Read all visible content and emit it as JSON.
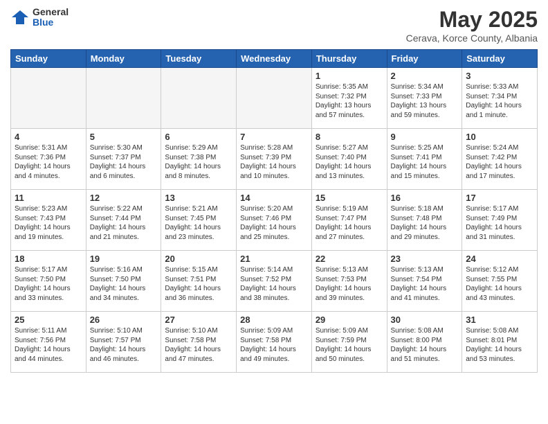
{
  "logo": {
    "general": "General",
    "blue": "Blue"
  },
  "title": "May 2025",
  "subtitle": "Cerava, Korce County, Albania",
  "headers": [
    "Sunday",
    "Monday",
    "Tuesday",
    "Wednesday",
    "Thursday",
    "Friday",
    "Saturday"
  ],
  "weeks": [
    [
      {
        "num": "",
        "info": ""
      },
      {
        "num": "",
        "info": ""
      },
      {
        "num": "",
        "info": ""
      },
      {
        "num": "",
        "info": ""
      },
      {
        "num": "1",
        "info": "Sunrise: 5:35 AM\nSunset: 7:32 PM\nDaylight: 13 hours\nand 57 minutes."
      },
      {
        "num": "2",
        "info": "Sunrise: 5:34 AM\nSunset: 7:33 PM\nDaylight: 13 hours\nand 59 minutes."
      },
      {
        "num": "3",
        "info": "Sunrise: 5:33 AM\nSunset: 7:34 PM\nDaylight: 14 hours\nand 1 minute."
      }
    ],
    [
      {
        "num": "4",
        "info": "Sunrise: 5:31 AM\nSunset: 7:36 PM\nDaylight: 14 hours\nand 4 minutes."
      },
      {
        "num": "5",
        "info": "Sunrise: 5:30 AM\nSunset: 7:37 PM\nDaylight: 14 hours\nand 6 minutes."
      },
      {
        "num": "6",
        "info": "Sunrise: 5:29 AM\nSunset: 7:38 PM\nDaylight: 14 hours\nand 8 minutes."
      },
      {
        "num": "7",
        "info": "Sunrise: 5:28 AM\nSunset: 7:39 PM\nDaylight: 14 hours\nand 10 minutes."
      },
      {
        "num": "8",
        "info": "Sunrise: 5:27 AM\nSunset: 7:40 PM\nDaylight: 14 hours\nand 13 minutes."
      },
      {
        "num": "9",
        "info": "Sunrise: 5:25 AM\nSunset: 7:41 PM\nDaylight: 14 hours\nand 15 minutes."
      },
      {
        "num": "10",
        "info": "Sunrise: 5:24 AM\nSunset: 7:42 PM\nDaylight: 14 hours\nand 17 minutes."
      }
    ],
    [
      {
        "num": "11",
        "info": "Sunrise: 5:23 AM\nSunset: 7:43 PM\nDaylight: 14 hours\nand 19 minutes."
      },
      {
        "num": "12",
        "info": "Sunrise: 5:22 AM\nSunset: 7:44 PM\nDaylight: 14 hours\nand 21 minutes."
      },
      {
        "num": "13",
        "info": "Sunrise: 5:21 AM\nSunset: 7:45 PM\nDaylight: 14 hours\nand 23 minutes."
      },
      {
        "num": "14",
        "info": "Sunrise: 5:20 AM\nSunset: 7:46 PM\nDaylight: 14 hours\nand 25 minutes."
      },
      {
        "num": "15",
        "info": "Sunrise: 5:19 AM\nSunset: 7:47 PM\nDaylight: 14 hours\nand 27 minutes."
      },
      {
        "num": "16",
        "info": "Sunrise: 5:18 AM\nSunset: 7:48 PM\nDaylight: 14 hours\nand 29 minutes."
      },
      {
        "num": "17",
        "info": "Sunrise: 5:17 AM\nSunset: 7:49 PM\nDaylight: 14 hours\nand 31 minutes."
      }
    ],
    [
      {
        "num": "18",
        "info": "Sunrise: 5:17 AM\nSunset: 7:50 PM\nDaylight: 14 hours\nand 33 minutes."
      },
      {
        "num": "19",
        "info": "Sunrise: 5:16 AM\nSunset: 7:50 PM\nDaylight: 14 hours\nand 34 minutes."
      },
      {
        "num": "20",
        "info": "Sunrise: 5:15 AM\nSunset: 7:51 PM\nDaylight: 14 hours\nand 36 minutes."
      },
      {
        "num": "21",
        "info": "Sunrise: 5:14 AM\nSunset: 7:52 PM\nDaylight: 14 hours\nand 38 minutes."
      },
      {
        "num": "22",
        "info": "Sunrise: 5:13 AM\nSunset: 7:53 PM\nDaylight: 14 hours\nand 39 minutes."
      },
      {
        "num": "23",
        "info": "Sunrise: 5:13 AM\nSunset: 7:54 PM\nDaylight: 14 hours\nand 41 minutes."
      },
      {
        "num": "24",
        "info": "Sunrise: 5:12 AM\nSunset: 7:55 PM\nDaylight: 14 hours\nand 43 minutes."
      }
    ],
    [
      {
        "num": "25",
        "info": "Sunrise: 5:11 AM\nSunset: 7:56 PM\nDaylight: 14 hours\nand 44 minutes."
      },
      {
        "num": "26",
        "info": "Sunrise: 5:10 AM\nSunset: 7:57 PM\nDaylight: 14 hours\nand 46 minutes."
      },
      {
        "num": "27",
        "info": "Sunrise: 5:10 AM\nSunset: 7:58 PM\nDaylight: 14 hours\nand 47 minutes."
      },
      {
        "num": "28",
        "info": "Sunrise: 5:09 AM\nSunset: 7:58 PM\nDaylight: 14 hours\nand 49 minutes."
      },
      {
        "num": "29",
        "info": "Sunrise: 5:09 AM\nSunset: 7:59 PM\nDaylight: 14 hours\nand 50 minutes."
      },
      {
        "num": "30",
        "info": "Sunrise: 5:08 AM\nSunset: 8:00 PM\nDaylight: 14 hours\nand 51 minutes."
      },
      {
        "num": "31",
        "info": "Sunrise: 5:08 AM\nSunset: 8:01 PM\nDaylight: 14 hours\nand 53 minutes."
      }
    ]
  ]
}
